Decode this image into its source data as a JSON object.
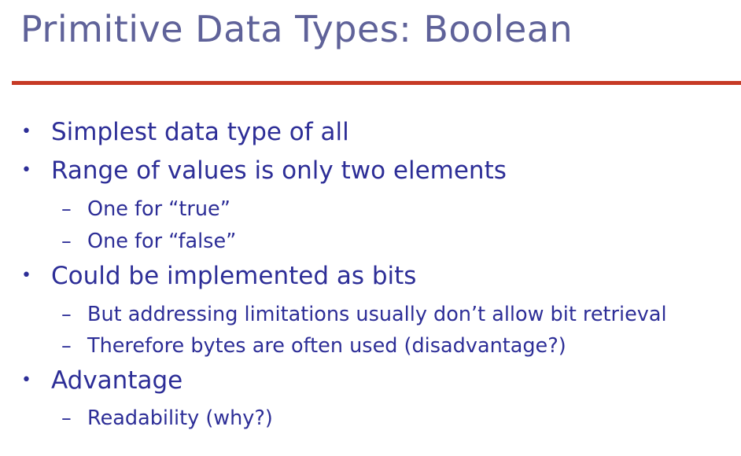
{
  "slide": {
    "title": "Primitive Data Types: Boolean",
    "accent_color": "#c63a25",
    "title_color": "#5f6299",
    "text_color": "#2d2e97",
    "bullet_marker": "•",
    "sub_marker": "–",
    "items": [
      {
        "level": 1,
        "text": "Simplest data type of all"
      },
      {
        "level": 1,
        "text": "Range of values is only two elements"
      },
      {
        "level": 2,
        "text": "One for “true”"
      },
      {
        "level": 2,
        "text": "One for “false”"
      },
      {
        "level": 1,
        "text": "Could be implemented as bits"
      },
      {
        "level": 2,
        "text": "But addressing limitations usually don’t allow bit retrieval"
      },
      {
        "level": 2,
        "text": "Therefore bytes are often used (disadvantage?)"
      },
      {
        "level": 1,
        "text": "Advantage"
      },
      {
        "level": 2,
        "text": "Readability (why?)"
      }
    ]
  }
}
